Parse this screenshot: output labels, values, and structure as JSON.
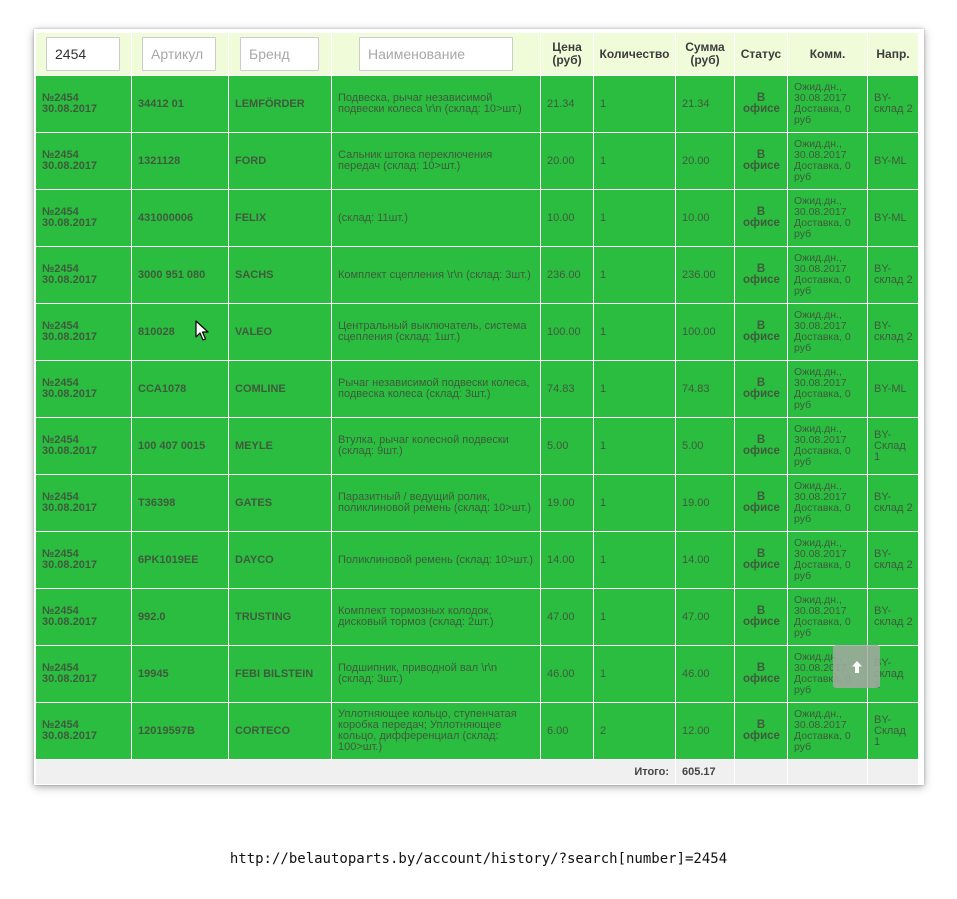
{
  "filters": {
    "number_value": "2454",
    "article_placeholder": "Артикул",
    "brand_placeholder": "Бренд",
    "name_placeholder": "Наименование"
  },
  "headers": {
    "price": "Цена\n(руб)",
    "quantity": "Количество",
    "sum": "Сумма\n(руб)",
    "status": "Статус",
    "comment": "Комм.",
    "direction": "Напр."
  },
  "rows": [
    {
      "order": "№2454",
      "date": "30.08.2017",
      "article": "34412 01",
      "brand": "LEMFÖRDER",
      "name": "Подвеска, рычаг независимой подвески колеса \\r\\n (склад: 10>шт.)",
      "price": "21.34",
      "qty": "1",
      "sum": "21.34",
      "status": "В офисе",
      "comment": "Ожид.дн.,\n30.08.2017\nДоставка, 0\nруб",
      "direction": "BY-\nсклад 2"
    },
    {
      "order": "№2454",
      "date": "30.08.2017",
      "article": "1321128",
      "brand": "FORD",
      "name": "Сальник штока переключения передач (склад: 10>шт.)",
      "price": "20.00",
      "qty": "1",
      "sum": "20.00",
      "status": "В офисе",
      "comment": "Ожид.дн.,\n30.08.2017\nДоставка, 0\nруб",
      "direction": "BY-ML"
    },
    {
      "order": "№2454",
      "date": "30.08.2017",
      "article": "431000006",
      "brand": "FELIX",
      "name": "(склад: 11шт.)",
      "price": "10.00",
      "qty": "1",
      "sum": "10.00",
      "status": "В офисе",
      "comment": "Ожид.дн.,\n30.08.2017\nДоставка, 0\nруб",
      "direction": "BY-ML"
    },
    {
      "order": "№2454",
      "date": "30.08.2017",
      "article": "3000 951 080",
      "brand": "SACHS",
      "name": "Комплект сцепления \\r\\n (склад: 3шт.)",
      "price": "236.00",
      "qty": "1",
      "sum": "236.00",
      "status": "В офисе",
      "comment": "Ожид.дн.,\n30.08.2017\nДоставка, 0\nруб",
      "direction": "BY-\nсклад 2"
    },
    {
      "order": "№2454",
      "date": "30.08.2017",
      "article": "810028",
      "brand": "VALEO",
      "name": "Центральный выключатель, система сцепления (склад: 1шт.)",
      "price": "100.00",
      "qty": "1",
      "sum": "100.00",
      "status": "В офисе",
      "comment": "Ожид.дн.,\n30.08.2017\nДоставка, 0\nруб",
      "direction": "BY-\nсклад 2"
    },
    {
      "order": "№2454",
      "date": "30.08.2017",
      "article": "CCA1078",
      "brand": "COMLINE",
      "name": "Рычаг независимой подвески колеса, подвеска колеса (склад: 3шт.)",
      "price": "74.83",
      "qty": "1",
      "sum": "74.83",
      "status": "В офисе",
      "comment": "Ожид.дн.,\n30.08.2017\nДоставка, 0\nруб",
      "direction": "BY-ML"
    },
    {
      "order": "№2454",
      "date": "30.08.2017",
      "article": "100 407 0015",
      "brand": "MEYLE",
      "name": "Втулка, рычаг колесной подвески (склад: 9шт.)",
      "price": "5.00",
      "qty": "1",
      "sum": "5.00",
      "status": "В офисе",
      "comment": "Ожид.дн.,\n30.08.2017\nДоставка, 0\nруб",
      "direction": "BY-\nСклад\n1"
    },
    {
      "order": "№2454",
      "date": "30.08.2017",
      "article": "T36398",
      "brand": "GATES",
      "name": "Паразитный / ведущий ролик, поликлиновой ремень (склад: 10>шт.)",
      "price": "19.00",
      "qty": "1",
      "sum": "19.00",
      "status": "В офисе",
      "comment": "Ожид.дн.,\n30.08.2017\nДоставка, 0\nруб",
      "direction": "BY-\nсклад 2"
    },
    {
      "order": "№2454",
      "date": "30.08.2017",
      "article": "6PK1019EE",
      "brand": "DAYCO",
      "name": "Поликлиновой ремень (склад: 10>шт.)",
      "price": "14.00",
      "qty": "1",
      "sum": "14.00",
      "status": "В офисе",
      "comment": "Ожид.дн.,\n30.08.2017\nДоставка, 0\nруб",
      "direction": "BY-\nсклад 2"
    },
    {
      "order": "№2454",
      "date": "30.08.2017",
      "article": "992.0",
      "brand": "TRUSTING",
      "name": "Комплект тормозных колодок, дисковый тормоз (склад: 2шт.)",
      "price": "47.00",
      "qty": "1",
      "sum": "47.00",
      "status": "В офисе",
      "comment": "Ожид.дн.,\n30.08.2017\nДоставка, 0\nруб",
      "direction": "BY-\nсклад 2"
    },
    {
      "order": "№2454",
      "date": "30.08.2017",
      "article": "19945",
      "brand": "FEBI BILSTEIN",
      "name": "Подшипник, приводной вал \\r\\n (склад: 3шт.)",
      "price": "46.00",
      "qty": "1",
      "sum": "46.00",
      "status": "В офисе",
      "comment": "Ожид.дн.,\n30.08.2017\nДоставка, 0\nруб",
      "direction": "BY-\nсклад\n1"
    },
    {
      "order": "№2454",
      "date": "30.08.2017",
      "article": "12019597B",
      "brand": "CORTECO",
      "name": "Уплотняющее кольцо, ступенчатая коробка передач; Уплотняющее кольцо, дифференциал (склад: 100>шт.)",
      "price": "6.00",
      "qty": "2",
      "sum": "12.00",
      "status": "В офисе",
      "comment": "Ожид.дн.,\n30.08.2017\nДоставка, 0\nруб",
      "direction": "BY-\nСклад\n1"
    }
  ],
  "footer": {
    "total_label": "Итого:",
    "total_value": "605.17"
  },
  "url": "http://belautoparts.by/account/history/?search[number]=2454",
  "icons": {
    "scroll_top": "arrow-up-icon",
    "cursor": "mouse-pointer-icon"
  },
  "colors": {
    "row_bg": "#2bbd40",
    "header_bg": "#f0fbd9",
    "text": "#3f5a3c"
  }
}
